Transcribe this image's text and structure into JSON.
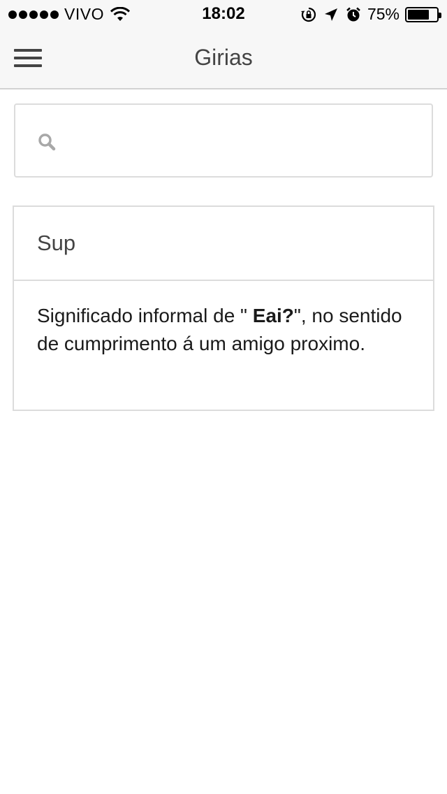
{
  "status_bar": {
    "carrier": "VIVO",
    "time": "18:02",
    "battery_percent": "75%",
    "battery_level": 0.75,
    "icons": [
      "signal-dots-icon",
      "wifi-icon",
      "rotation-lock-icon",
      "location-arrow-icon",
      "alarm-icon",
      "battery-icon"
    ]
  },
  "header": {
    "title": "Girias",
    "menu_icon": "hamburger-menu-icon"
  },
  "search": {
    "value": "",
    "placeholder": "",
    "icon": "search-icon"
  },
  "card": {
    "title": "Sup",
    "body_before": "Significado informal de \" ",
    "body_bold": "Eai?",
    "body_after": "\", no sentido de cumprimento á um amigo proximo."
  }
}
